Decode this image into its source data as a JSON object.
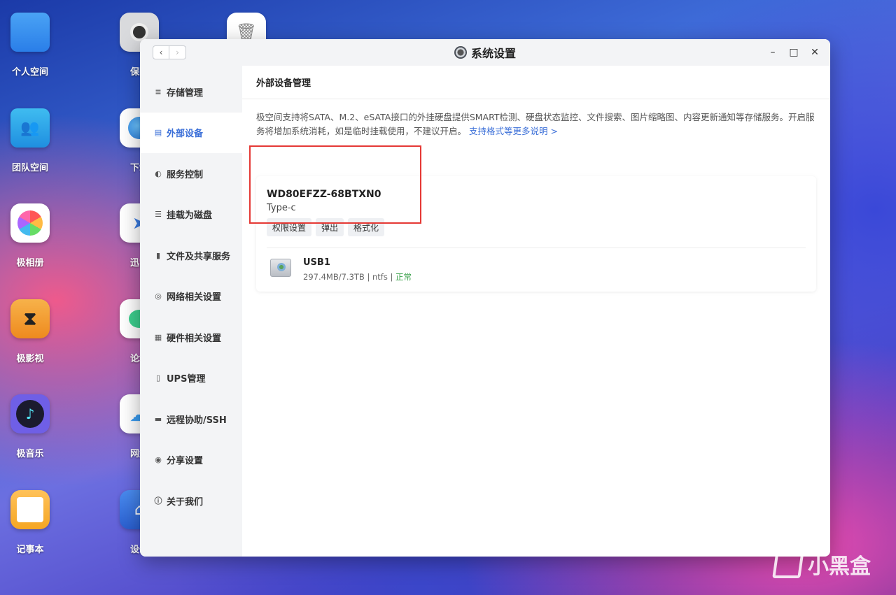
{
  "desktop": {
    "icons_left": [
      {
        "label": "个人空间",
        "icon": "folder-icon"
      },
      {
        "label": "团队空间",
        "icon": "team-folder-icon"
      },
      {
        "label": "极相册",
        "icon": "photos-icon"
      },
      {
        "label": "极影视",
        "icon": "video-icon"
      },
      {
        "label": "极音乐",
        "icon": "music-icon"
      },
      {
        "label": "记事本",
        "icon": "notes-icon"
      }
    ],
    "icons_second": [
      {
        "label": "保险",
        "icon": "safe-icon"
      },
      {
        "label": "下载",
        "icon": "download-icon"
      },
      {
        "label": "迅雷",
        "icon": "thunder-icon"
      },
      {
        "label": "论坛",
        "icon": "forum-icon"
      },
      {
        "label": "网盘",
        "icon": "cloud-icon"
      },
      {
        "label": "设备",
        "icon": "device-icon"
      }
    ],
    "trash_icon": "trash-icon"
  },
  "window": {
    "title": "系统设置",
    "back": "‹",
    "forward": "›",
    "minimize": "–",
    "maximize": "□",
    "close": "✕"
  },
  "sidebar": {
    "items": [
      {
        "label": "存储管理",
        "icon": "storage-icon",
        "glyph": "≡"
      },
      {
        "label": "外部设备",
        "icon": "external-device-icon",
        "glyph": "▤"
      },
      {
        "label": "服务控制",
        "icon": "toggle-icon",
        "glyph": "◐"
      },
      {
        "label": "挂载为磁盘",
        "icon": "mount-icon",
        "glyph": "☰"
      },
      {
        "label": "文件及共享服务",
        "icon": "file-share-icon",
        "glyph": "▮"
      },
      {
        "label": "网络相关设置",
        "icon": "network-icon",
        "glyph": "◎"
      },
      {
        "label": "硬件相关设置",
        "icon": "hardware-icon",
        "glyph": "▦"
      },
      {
        "label": "UPS管理",
        "icon": "ups-icon",
        "glyph": "▯"
      },
      {
        "label": "远程协助/SSH",
        "icon": "remote-icon",
        "glyph": "▬"
      },
      {
        "label": "分享设置",
        "icon": "share-icon",
        "glyph": "◉"
      },
      {
        "label": "关于我们",
        "icon": "info-icon",
        "glyph": "ⓘ"
      }
    ],
    "active_index": 1
  },
  "main": {
    "header": "外部设备管理",
    "description": "极空间支持将SATA、M.2、eSATA接口的外挂硬盘提供SMART检测、硬盘状态监控、文件搜索、图片缩略图、内容更新通知等存储服务。开启服务将增加系统消耗，如是临时挂载使用，不建议开启。",
    "link": "支持格式等更多说明 >",
    "device": {
      "name": "WD80EFZZ-68BTXN0",
      "type": "Type-c",
      "buttons": [
        "权限设置",
        "弹出",
        "格式化"
      ]
    },
    "partition": {
      "name": "USB1",
      "usage": "297.4MB/7.3TB",
      "fs": "ntfs",
      "status": "正常",
      "status_color": "#3aa14a"
    }
  },
  "watermark": "小黑盒"
}
